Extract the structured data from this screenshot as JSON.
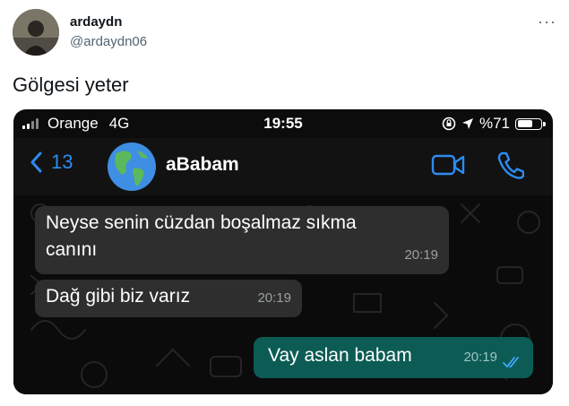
{
  "tweet": {
    "username": "ardaydn",
    "handle": "@ardaydn06",
    "more": "···",
    "text": "Gölgesi yeter"
  },
  "phone": {
    "carrier": "Orange",
    "network": "4G",
    "time": "19:55",
    "battery_text": "%71",
    "battery_level": 0.71
  },
  "chat_header": {
    "back_count": "13",
    "contact_name": "aBabam"
  },
  "messages": [
    {
      "direction": "incoming",
      "text_lines": [
        "Neyse senin cüzdan boşalmaz sıkma",
        "canını"
      ],
      "time": "20:19"
    },
    {
      "direction": "incoming",
      "text_lines": [
        "Dağ gibi biz varız"
      ],
      "time": "20:19"
    },
    {
      "direction": "outgoing",
      "text_lines": [
        "Vay aslan babam"
      ],
      "time": "20:19",
      "read": true
    }
  ],
  "colors": {
    "accent_blue": "#2d8cf0",
    "incoming_bubble": "#2e2e2e",
    "outgoing_bubble": "#0c5c55",
    "read_ticks": "#3ea6ff"
  }
}
